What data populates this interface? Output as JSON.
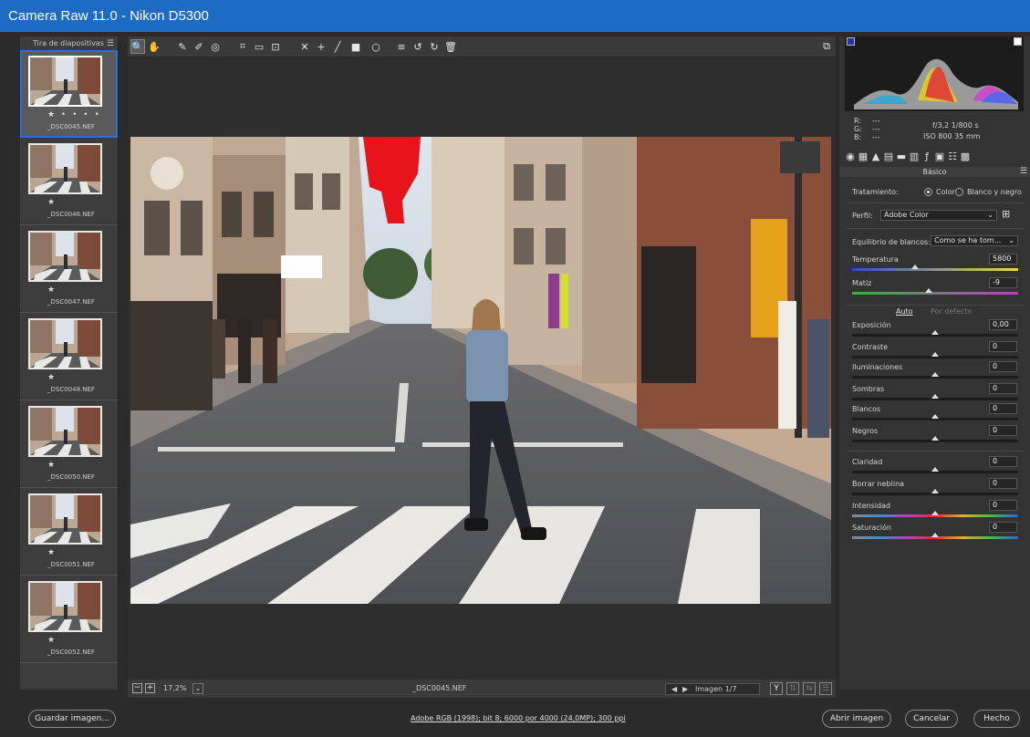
{
  "window": {
    "title": "Camera Raw 11.0 -  Nikon D5300"
  },
  "filmstrip": {
    "header": "Tira de diapositivas",
    "items": [
      {
        "name": "_DSC0045.NEF",
        "stars": "★ • • • •",
        "selected": true
      },
      {
        "name": "_DSC0046.NEF",
        "stars": "★",
        "selected": false
      },
      {
        "name": "_DSC0047.NEF",
        "stars": "★",
        "selected": false
      },
      {
        "name": "_DSC0048.NEF",
        "stars": "★",
        "selected": false
      },
      {
        "name": "_DSC0050.NEF",
        "stars": "★",
        "selected": false
      },
      {
        "name": "_DSC0051.NEF",
        "stars": "★",
        "selected": false
      },
      {
        "name": "_DSC0052.NEF",
        "stars": "★",
        "selected": false
      }
    ]
  },
  "toolbar": {
    "tools": [
      {
        "id": "zoom",
        "icon": "zoom-icon",
        "glyph": "🔍"
      },
      {
        "id": "hand",
        "icon": "hand-icon",
        "glyph": "✋"
      },
      {
        "id": "white-balance",
        "icon": "eyedropper-icon",
        "glyph": "✎"
      },
      {
        "id": "color-sampler",
        "icon": "color-sampler-icon",
        "glyph": "✐"
      },
      {
        "id": "targeted-adjust",
        "icon": "target-adjust-icon",
        "glyph": "◎"
      },
      {
        "id": "crop",
        "icon": "crop-icon",
        "glyph": "⌗"
      },
      {
        "id": "straighten",
        "icon": "straighten-icon",
        "glyph": "▭"
      },
      {
        "id": "transform",
        "icon": "transform-icon",
        "glyph": "⊡"
      },
      {
        "id": "spot-removal",
        "icon": "spot-removal-icon",
        "glyph": "✕"
      },
      {
        "id": "red-eye",
        "icon": "red-eye-icon",
        "glyph": "+"
      },
      {
        "id": "adjust-brush",
        "icon": "brush-icon",
        "glyph": "╱"
      },
      {
        "id": "graduated-filter",
        "icon": "graduated-filter-icon",
        "glyph": "■"
      },
      {
        "id": "radial-filter",
        "icon": "radial-filter-icon",
        "glyph": "○"
      },
      {
        "id": "preferences",
        "icon": "list-icon",
        "glyph": "≡"
      },
      {
        "id": "rotate-left",
        "icon": "rotate-left-icon",
        "glyph": "↺"
      },
      {
        "id": "rotate-right",
        "icon": "rotate-right-icon",
        "glyph": "↻"
      },
      {
        "id": "delete",
        "icon": "trash-icon",
        "glyph": "🗑"
      }
    ],
    "fullscreen_glyph": "⧉"
  },
  "canvas_status": {
    "zoom_minus": "−",
    "zoom_plus": "+",
    "zoom": "17,2%",
    "zoom_arrow": "⌄",
    "filename": "_DSC0045.NEF",
    "prev": "◀",
    "next": "▶",
    "image_counter": "Imagen 1/7",
    "view_y": "Y"
  },
  "histogram": {
    "readout": {
      "r": "R:",
      "g": "G:",
      "b": "B:",
      "dash": "---",
      "aperture_shutter": "f/3,2   1/800 s",
      "iso_focal": "ISO 800   35 mm"
    }
  },
  "panel": {
    "section": "Básico",
    "treatment_label": "Tratamiento:",
    "treatment_color": "Color",
    "treatment_bw": "Blanco y negro",
    "profile_label": "Perfil:",
    "profile_value": "Adobe Color",
    "wb_label": "Equilibrio de blancos:",
    "wb_value": "Como se ha tom...",
    "auto": "Auto",
    "default": "Por defecto",
    "sliders": [
      {
        "label": "Temperatura",
        "value": "5800",
        "pos": 0.38
      },
      {
        "label": "Matiz",
        "value": "-9",
        "pos": 0.46
      },
      {
        "label": "Exposición",
        "value": "0,00",
        "pos": 0.5
      },
      {
        "label": "Contraste",
        "value": "0",
        "pos": 0.5
      },
      {
        "label": "Iluminaciones",
        "value": "0",
        "pos": 0.5
      },
      {
        "label": "Sombras",
        "value": "0",
        "pos": 0.5
      },
      {
        "label": "Blancos",
        "value": "0",
        "pos": 0.5
      },
      {
        "label": "Negros",
        "value": "0",
        "pos": 0.5
      },
      {
        "label": "Claridad",
        "value": "0",
        "pos": 0.5
      },
      {
        "label": "Borrar neblina",
        "value": "0",
        "pos": 0.5
      },
      {
        "label": "Intensidad",
        "value": "0",
        "pos": 0.5
      },
      {
        "label": "Saturación",
        "value": "0",
        "pos": 0.5
      }
    ]
  },
  "footer": {
    "save": "Guardar imagen...",
    "workflow": "Adobe RGB (1998); bit 8; 6000 por 4000 (24,0MP); 300 ppi",
    "open": "Abrir imagen",
    "cancel": "Cancelar",
    "done": "Hecho"
  },
  "colors": {
    "title_bar": "#1e6bc4",
    "accent": "#2f6ed6",
    "clip_warning": "#e8141c"
  }
}
